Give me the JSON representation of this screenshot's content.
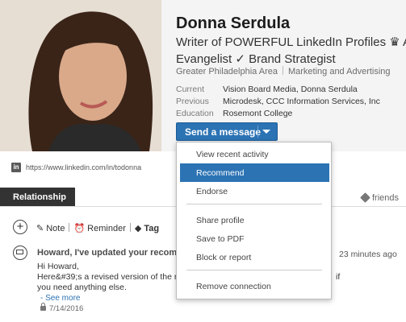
{
  "profile": {
    "name": "Donna Serdula",
    "headline_line1": "Writer of POWERFUL LinkedIn Profiles ♛ Aut",
    "headline_line2": "Evangelist ✓ Brand Strategist",
    "location": "Greater Philadelphia Area",
    "industry": "Marketing and Advertising",
    "current_label": "Current",
    "current_value": "Vision Board Media, Donna Serdula",
    "previous_label": "Previous",
    "previous_value": "Microdesk, CCC Information Services, Inc",
    "education_label": "Education",
    "education_value": "Rosemont College",
    "url": "https://www.linkedin.com/in/todonna",
    "linkedin_icon_text": "in"
  },
  "send_button": {
    "label": "Send a message"
  },
  "dropdown": {
    "items": [
      {
        "label": "View recent activity"
      },
      {
        "label": "Recommend"
      },
      {
        "label": "Endorse"
      },
      {
        "label": "Share profile"
      },
      {
        "label": "Save to PDF"
      },
      {
        "label": "Block or report"
      },
      {
        "label": "Remove connection"
      }
    ],
    "active_index": 1
  },
  "relationship": {
    "tab_label": "Relationship",
    "friends_tag": "friends",
    "actions": {
      "note": "Note",
      "reminder": "Reminder",
      "tag": "Tag"
    },
    "message": {
      "subject": "Howard, I've updated your recomm",
      "time": "23 minutes ago",
      "line1": "Hi Howard,",
      "line2": "Here&#39;s a revised version of the rec",
      "line3": "you need anything else.",
      "if_fragment": "if",
      "see_more": "- See more",
      "date": "7/14/2016"
    }
  },
  "colors": {
    "accent": "#2c73b4",
    "tab_dark": "#333333"
  }
}
